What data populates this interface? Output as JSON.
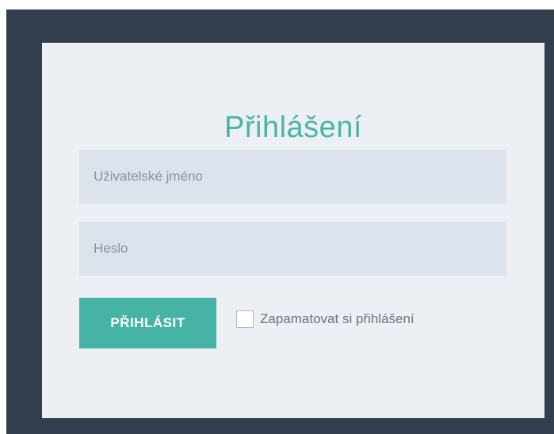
{
  "login": {
    "title": "Přihlášení",
    "username_placeholder": "Uživatelské jméno",
    "username_value": "",
    "password_placeholder": "Heslo",
    "password_value": "",
    "submit_label": "PŘIHLÁSIT",
    "remember_label": "Zapamatovat si přihlášení",
    "remember_checked": false
  },
  "colors": {
    "frame_background": "#323e4d",
    "card_background": "#eceff3",
    "accent": "#46b3a4",
    "input_background": "#dde3ec"
  }
}
